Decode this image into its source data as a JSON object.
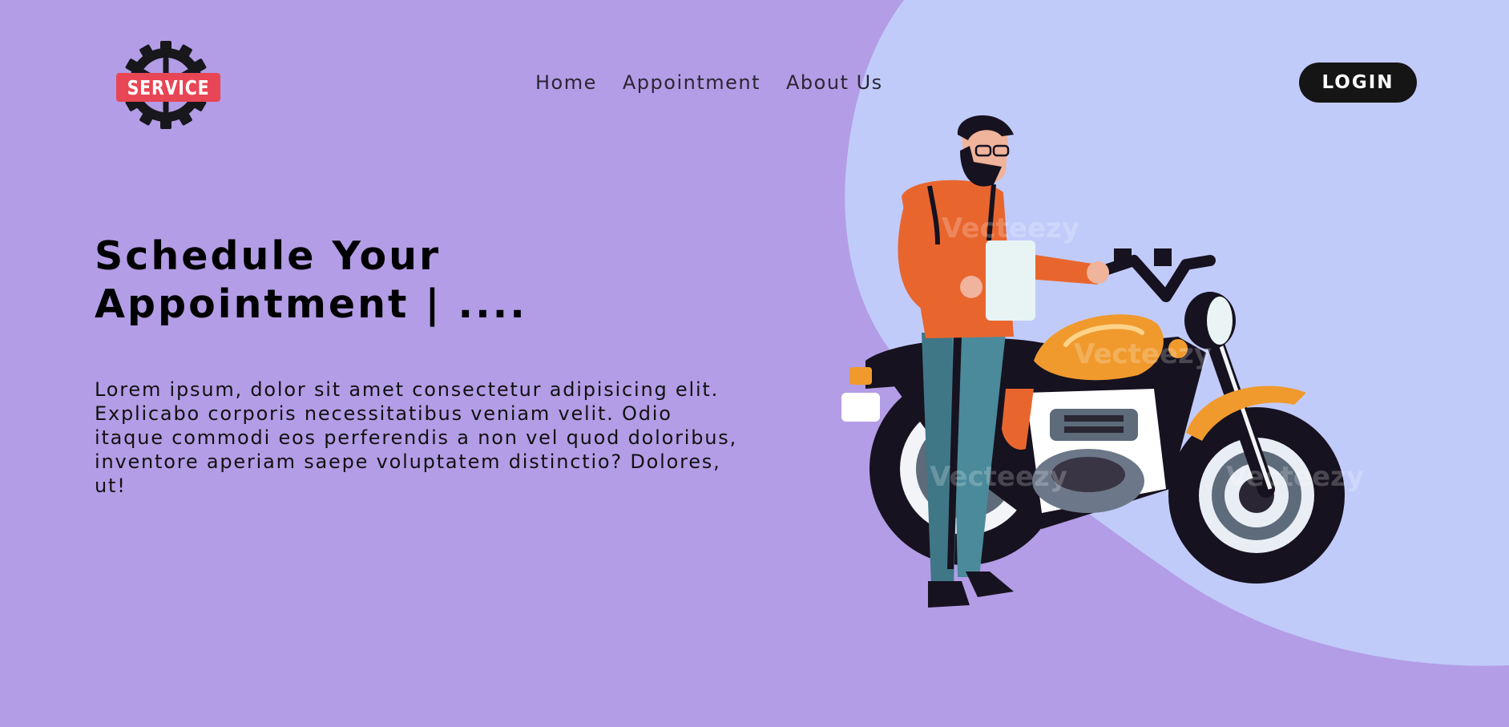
{
  "logo": {
    "text": "SERVICE"
  },
  "nav": {
    "items": [
      {
        "label": "Home"
      },
      {
        "label": "Appointment"
      },
      {
        "label": "About Us"
      }
    ]
  },
  "login": {
    "label": "LOGIN"
  },
  "hero": {
    "title_line1": "Schedule Your",
    "title_line2": "Appointment | ....",
    "description": "Lorem ipsum, dolor sit amet consectetur adipisicing elit. Explicabo corporis necessitatibus veniam velit. Odio itaque commodi eos perferendis a non vel quod doloribus, inventore aperiam saepe voluptatem distinctio? Dolores, ut!"
  },
  "illustration": {
    "subject": "mechanic-with-motorcycle",
    "watermark": "Vecteezy"
  },
  "colors": {
    "background": "#b39de6",
    "blob": "#c1cbfa",
    "logo_badge": "#e84655",
    "login_bg": "#151515",
    "shirt": "#e8662e",
    "tank": "#f09a2e"
  }
}
